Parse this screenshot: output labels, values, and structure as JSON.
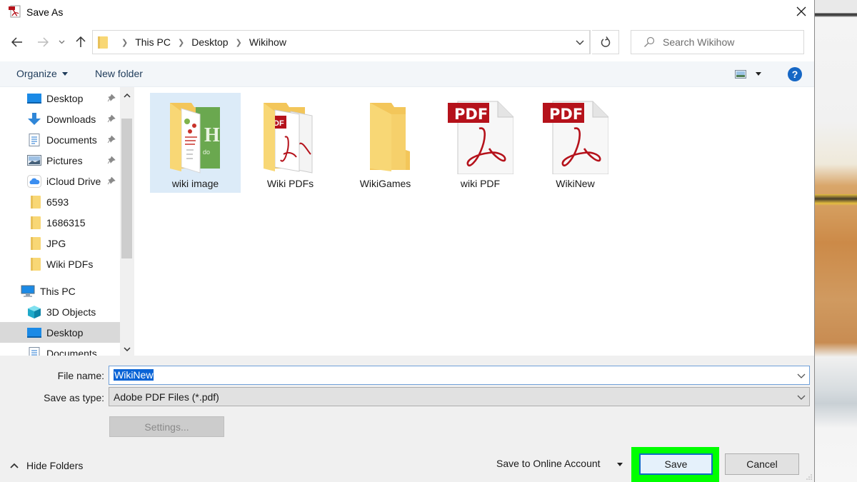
{
  "window": {
    "title": "Save As"
  },
  "navigation": {
    "breadcrumb": [
      "This PC",
      "Desktop",
      "Wikihow"
    ],
    "search_placeholder": "Search Wikihow"
  },
  "toolbar": {
    "organize_label": "Organize",
    "new_folder_label": "New folder",
    "help_label": "?"
  },
  "sidebar": {
    "quick_access": [
      {
        "label": "Desktop",
        "icon": "desktop-icon",
        "pinned": true
      },
      {
        "label": "Downloads",
        "icon": "download-arrow-icon",
        "pinned": true
      },
      {
        "label": "Documents",
        "icon": "documents-icon",
        "pinned": true
      },
      {
        "label": "Pictures",
        "icon": "pictures-icon",
        "pinned": true
      },
      {
        "label": "iCloud Drive",
        "icon": "icloud-icon",
        "pinned": true
      },
      {
        "label": "6593",
        "icon": "folder-icon",
        "pinned": false
      },
      {
        "label": "1686315",
        "icon": "folder-icon",
        "pinned": false
      },
      {
        "label": "JPG",
        "icon": "folder-icon",
        "pinned": false
      },
      {
        "label": "Wiki PDFs",
        "icon": "folder-icon",
        "pinned": false
      }
    ],
    "this_pc": {
      "label": "This PC",
      "icon": "computer-icon"
    },
    "this_pc_items": [
      {
        "label": "3D Objects",
        "icon": "3d-objects-icon",
        "selected": false
      },
      {
        "label": "Desktop",
        "icon": "desktop-icon",
        "selected": true
      },
      {
        "label": "Documents",
        "icon": "documents-icon",
        "selected": false
      }
    ]
  },
  "files": [
    {
      "name": "wiki image",
      "type": "folder-with-images",
      "selected": true
    },
    {
      "name": "Wiki PDFs",
      "type": "folder-with-pdfs",
      "selected": false
    },
    {
      "name": "WikiGames",
      "type": "folder",
      "selected": false
    },
    {
      "name": "wiki PDF",
      "type": "pdf",
      "selected": false
    },
    {
      "name": "WikiNew",
      "type": "pdf",
      "selected": false
    }
  ],
  "form": {
    "file_name_label": "File name:",
    "file_name_value": "WikiNew",
    "save_as_type_label": "Save as type:",
    "save_as_type_value": "Adobe PDF Files (*.pdf)",
    "settings_label": "Settings..."
  },
  "footer": {
    "hide_folders_label": "Hide Folders",
    "online_account_label": "Save to Online Account",
    "save_label": "Save",
    "cancel_label": "Cancel"
  },
  "colors": {
    "highlight": "#00ff00",
    "accent": "#0f6cc4",
    "pdf_red": "#b5121b",
    "folder_yellow": "#f8d775"
  }
}
